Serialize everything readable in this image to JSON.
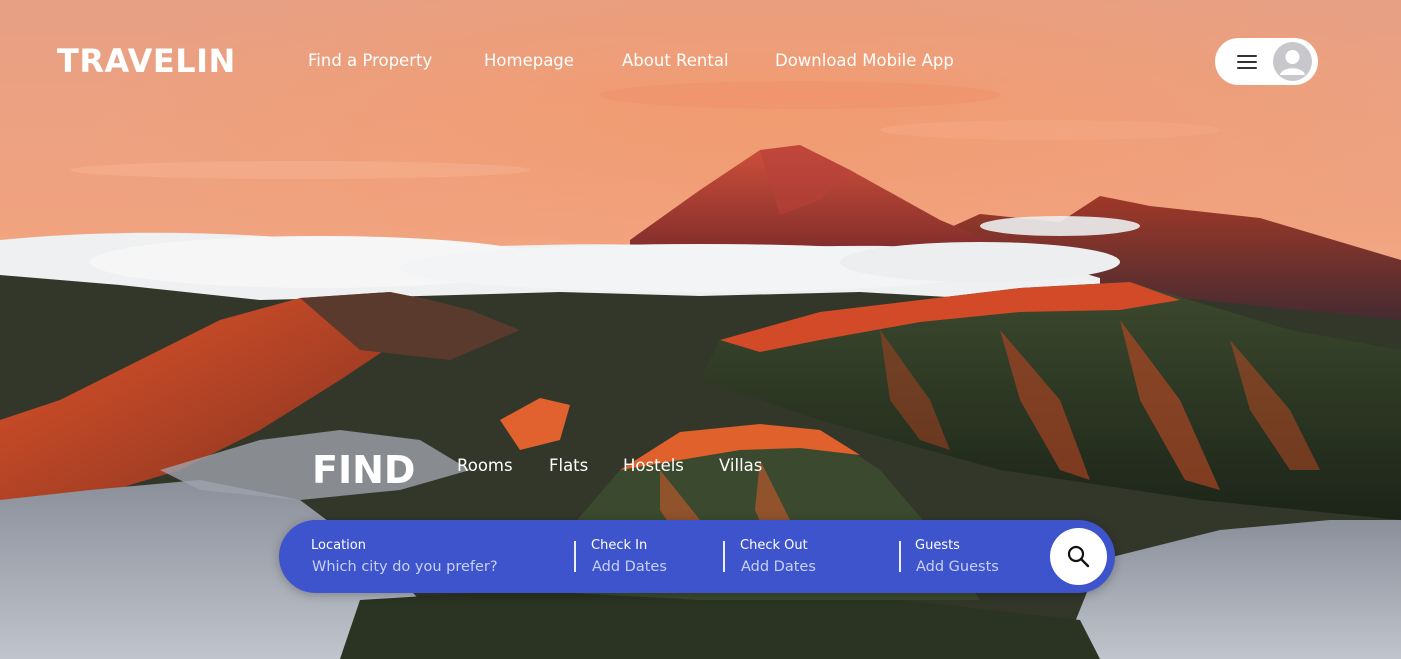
{
  "header": {
    "logo": "TRAVELIN",
    "nav": [
      "Find a Property",
      "Homepage",
      "About Rental",
      "Download Mobile App"
    ],
    "menu_icon": "hamburger-menu-icon",
    "avatar_icon": "user-avatar-icon"
  },
  "find": {
    "title": "FIND",
    "categories": [
      "Rooms",
      "Flats",
      "Hostels",
      "Villas"
    ]
  },
  "search": {
    "fields": [
      {
        "label": "Location",
        "placeholder": "Which city do you prefer?"
      },
      {
        "label": "Check In",
        "placeholder": "Add Dates"
      },
      {
        "label": "Check Out",
        "placeholder": "Add Dates"
      },
      {
        "label": "Guests",
        "placeholder": "Add Guests"
      }
    ],
    "button_icon": "search-icon"
  },
  "colors": {
    "search_bar": "#3d54cd",
    "text": "#ffffff",
    "placeholder": "#c9d0f5"
  }
}
